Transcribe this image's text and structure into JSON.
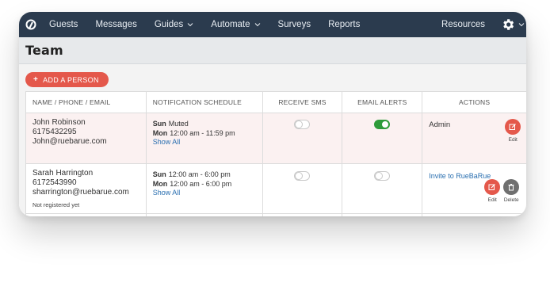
{
  "nav": {
    "items": [
      {
        "label": "Guests",
        "dropdown": false
      },
      {
        "label": "Messages",
        "dropdown": false
      },
      {
        "label": "Guides",
        "dropdown": true
      },
      {
        "label": "Automate",
        "dropdown": true
      },
      {
        "label": "Surveys",
        "dropdown": false
      },
      {
        "label": "Reports",
        "dropdown": false
      }
    ],
    "resources": "Resources",
    "colors": {
      "background": "#2b3b4e",
      "text": "#e8edf2"
    },
    "icons": [
      "logo-icon",
      "chevron-down-icon",
      "gear-icon"
    ]
  },
  "page": {
    "title": "Team"
  },
  "add_person": {
    "plus": "+",
    "label": "ADD A PERSON",
    "color": "#e4584b"
  },
  "table": {
    "headers": {
      "name": "NAME / PHONE / EMAIL",
      "schedule": "NOTIFICATION SCHEDULE",
      "sms": "RECEIVE SMS",
      "email": "EMAIL ALERTS",
      "actions": "ACTIONS"
    },
    "rows": [
      {
        "name": "John Robinson",
        "phone": "6175432295",
        "email": "John@ruebarue.com",
        "schedule": [
          {
            "day": "Sun",
            "value": "Muted"
          },
          {
            "day": "Mon",
            "value": "12:00 am - 11:59 pm"
          }
        ],
        "show_all": "Show All",
        "receive_sms": false,
        "email_alerts": true,
        "role": "Admin",
        "edit_label": "Edit"
      },
      {
        "name": "Sarah Harrington",
        "phone": "6172543990",
        "email": "sharrington@ruebarue.com",
        "note": "Not registered yet",
        "schedule": [
          {
            "day": "Sun",
            "value": "12:00 am - 6:00 pm"
          },
          {
            "day": "Mon",
            "value": "12:00 am - 6:00 pm"
          }
        ],
        "show_all": "Show All",
        "receive_sms": false,
        "email_alerts": false,
        "invite": "Invite to RueBaRue",
        "edit_label": "Edit",
        "delete_label": "Delete"
      }
    ]
  },
  "colors": {
    "accent": "#e4584b",
    "toggle_on": "#2e9b3a",
    "link": "#2a6fb0",
    "highlight_row": "#fbf1f1"
  }
}
